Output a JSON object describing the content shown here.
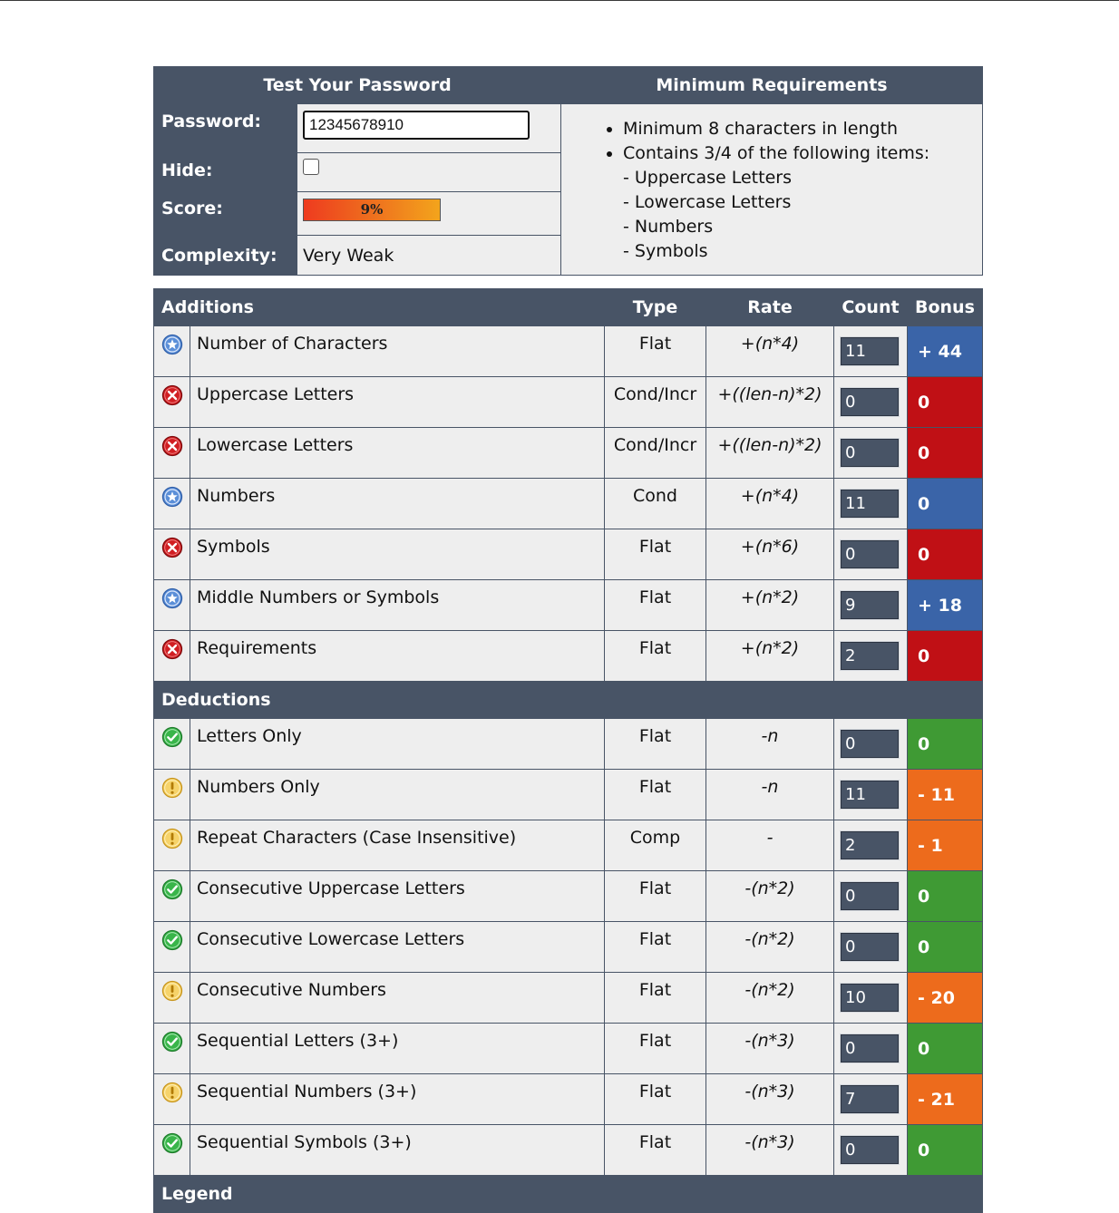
{
  "test": {
    "header_left": "Test Your Password",
    "header_right": "Minimum Requirements",
    "password_label": "Password:",
    "password_value": "12345678910",
    "hide_label": "Hide:",
    "score_label": "Score:",
    "score_value": "9%",
    "score_fraction": 0.09,
    "complexity_label": "Complexity:",
    "complexity_value": "Very Weak"
  },
  "requirements": {
    "item1": "Minimum 8 characters in length",
    "item2": "Contains 3/4 of the following items:",
    "sub": [
      "- Uppercase Letters",
      "- Lowercase Letters",
      "- Numbers",
      "- Symbols"
    ]
  },
  "table": {
    "additions_label": "Additions",
    "type_label": "Type",
    "rate_label": "Rate",
    "count_label": "Count",
    "bonus_label": "Bonus",
    "deductions_label": "Deductions",
    "legend_label": "Legend"
  },
  "colors": {
    "header": "#485466",
    "bonus_blue": "#3a64a8",
    "bonus_red": "#c01015",
    "bonus_green": "#3f9a34",
    "bonus_orange": "#ed6b1c"
  },
  "additions": [
    {
      "icon": "star-circle-icon",
      "name": "Number of Characters",
      "type": "Flat",
      "rate": "+(n*4)",
      "count": "11",
      "bonus": "+ 44",
      "status": "blue"
    },
    {
      "icon": "x-circle-icon",
      "name": "Uppercase Letters",
      "type": "Cond/Incr",
      "rate": "+((len-n)*2)",
      "count": "0",
      "bonus": "0",
      "status": "red"
    },
    {
      "icon": "x-circle-icon",
      "name": "Lowercase Letters",
      "type": "Cond/Incr",
      "rate": "+((len-n)*2)",
      "count": "0",
      "bonus": "0",
      "status": "red"
    },
    {
      "icon": "star-circle-icon",
      "name": "Numbers",
      "type": "Cond",
      "rate": "+(n*4)",
      "count": "11",
      "bonus": "0",
      "status": "blue"
    },
    {
      "icon": "x-circle-icon",
      "name": "Symbols",
      "type": "Flat",
      "rate": "+(n*6)",
      "count": "0",
      "bonus": "0",
      "status": "red"
    },
    {
      "icon": "star-circle-icon",
      "name": "Middle Numbers or Symbols",
      "type": "Flat",
      "rate": "+(n*2)",
      "count": "9",
      "bonus": "+ 18",
      "status": "blue"
    },
    {
      "icon": "x-circle-icon",
      "name": "Requirements",
      "type": "Flat",
      "rate": "+(n*2)",
      "count": "2",
      "bonus": "0",
      "status": "red"
    }
  ],
  "deductions": [
    {
      "icon": "check-circle-icon",
      "name": "Letters Only",
      "type": "Flat",
      "rate": "-n",
      "count": "0",
      "bonus": "0",
      "status": "green"
    },
    {
      "icon": "warning-circle-icon",
      "name": "Numbers Only",
      "type": "Flat",
      "rate": "-n",
      "count": "11",
      "bonus": "- 11",
      "status": "orange"
    },
    {
      "icon": "warning-circle-icon",
      "name": "Repeat Characters (Case Insensitive)",
      "type": "Comp",
      "rate": "-",
      "count": "2",
      "bonus": "- 1",
      "status": "orange"
    },
    {
      "icon": "check-circle-icon",
      "name": "Consecutive Uppercase Letters",
      "type": "Flat",
      "rate": "-(n*2)",
      "count": "0",
      "bonus": "0",
      "status": "green"
    },
    {
      "icon": "check-circle-icon",
      "name": "Consecutive Lowercase Letters",
      "type": "Flat",
      "rate": "-(n*2)",
      "count": "0",
      "bonus": "0",
      "status": "green"
    },
    {
      "icon": "warning-circle-icon",
      "name": "Consecutive Numbers",
      "type": "Flat",
      "rate": "-(n*2)",
      "count": "10",
      "bonus": "- 20",
      "status": "orange"
    },
    {
      "icon": "check-circle-icon",
      "name": "Sequential Letters (3+)",
      "type": "Flat",
      "rate": "-(n*3)",
      "count": "0",
      "bonus": "0",
      "status": "green"
    },
    {
      "icon": "warning-circle-icon",
      "name": "Sequential Numbers (3+)",
      "type": "Flat",
      "rate": "-(n*3)",
      "count": "7",
      "bonus": "- 21",
      "status": "orange"
    },
    {
      "icon": "check-circle-icon",
      "name": "Sequential Symbols (3+)",
      "type": "Flat",
      "rate": "-(n*3)",
      "count": "0",
      "bonus": "0",
      "status": "green"
    }
  ]
}
